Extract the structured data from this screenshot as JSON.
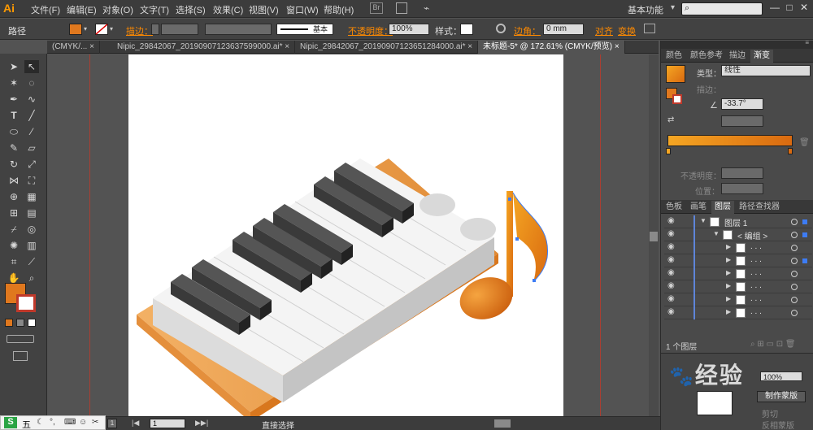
{
  "app": {
    "logo": "Ai"
  },
  "menu": [
    "文件(F)",
    "编辑(E)",
    "对象(O)",
    "文字(T)",
    "选择(S)",
    "效果(C)",
    "视图(V)",
    "窗口(W)",
    "帮助(H)"
  ],
  "workspace": "基本功能",
  "window_buttons": [
    "—",
    "□",
    "✕"
  ],
  "control": {
    "object_type": "路径",
    "stroke_label": "描边：",
    "stroke_style": "基本",
    "opacity_label": "不透明度：",
    "opacity_value": "100%",
    "style_label": "样式：",
    "corner_label": "边角：",
    "corner_value": "0 mm",
    "align_label": "对齐",
    "transform_label": "变换"
  },
  "tabs": [
    {
      "label": "(CMYK/...",
      "active": false
    },
    {
      "label": "Nipic_29842067_20190907123637599000.ai*",
      "active": false
    },
    {
      "label": "Nipic_29842067_20190907123651284000.ai*",
      "active": false
    },
    {
      "label": "未标题-5* @ 172.61% (CMYK/预览)",
      "active": true
    }
  ],
  "panel_gradient": {
    "tabs": [
      "颜色",
      "颜色参考",
      "描边",
      "渐变"
    ],
    "type_label": "类型：",
    "type_value": "线性",
    "stroke_label": "描边：",
    "angle_value": "-33.7°",
    "opacity_label": "不透明度：",
    "position_label": "位置："
  },
  "panel_layers": {
    "tabs": [
      "色板",
      "画笔",
      "图层",
      "路径查找器"
    ],
    "rows": [
      {
        "name": "图层 1",
        "indent": 0,
        "expanded": true,
        "selected": true
      },
      {
        "name": "< 编组 >",
        "indent": 1,
        "expanded": true,
        "selected": true
      },
      {
        "name": ". . .",
        "indent": 2,
        "expanded": false,
        "selected": false
      },
      {
        "name": ". . .",
        "indent": 2,
        "expanded": false,
        "selected": true
      },
      {
        "name": ". . .",
        "indent": 2,
        "expanded": false,
        "selected": false
      },
      {
        "name": ". . .",
        "indent": 2,
        "expanded": false,
        "selected": false
      },
      {
        "name": ". . .",
        "indent": 2,
        "expanded": false,
        "selected": false
      },
      {
        "name": ". . .",
        "indent": 2,
        "expanded": false,
        "selected": false
      }
    ],
    "footer": "1 个图层",
    "opacity_value": "100%",
    "make_mask": "制作蒙版",
    "clip_label": "剪切",
    "invert_label": "反相蒙版"
  },
  "status": {
    "zoom": "1",
    "mode": "直接选择"
  },
  "taskbar": {
    "ime": "五"
  },
  "watermark": "经验",
  "colors": {
    "accent": "#e0781e",
    "gradient_start": "#f5a623",
    "gradient_end": "#d96a10"
  }
}
